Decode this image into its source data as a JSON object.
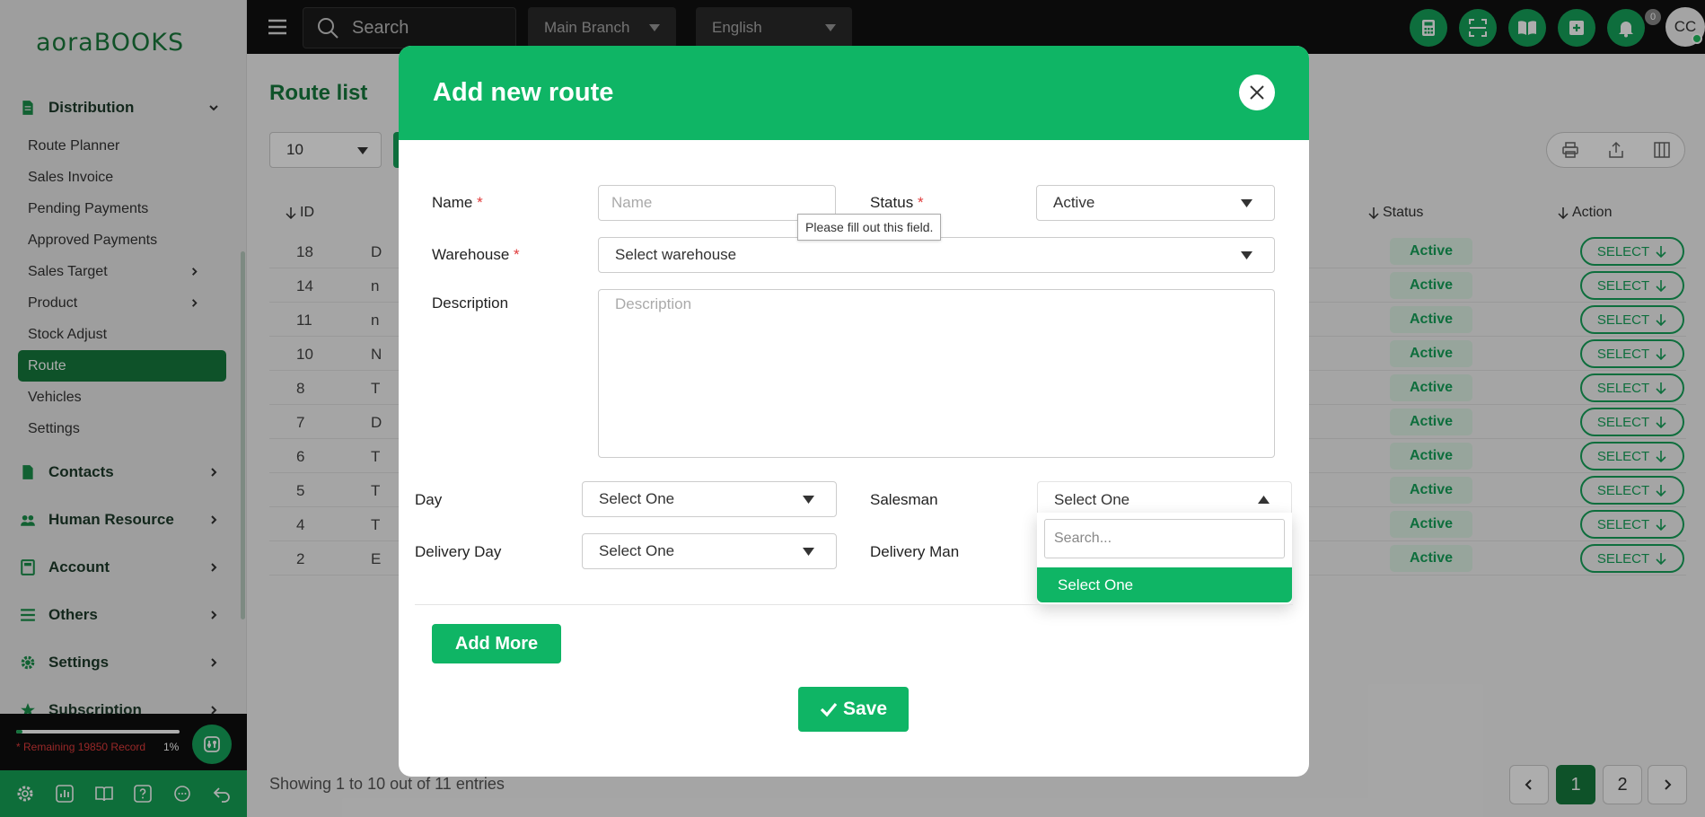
{
  "app": {
    "logo_text": "aoraBOOKS"
  },
  "sidebar": {
    "groups_top": [
      {
        "label": "Distribution",
        "icon": "document-icon"
      }
    ],
    "distribution_items": [
      {
        "label": "Route Planner"
      },
      {
        "label": "Sales Invoice"
      },
      {
        "label": "Pending Payments"
      },
      {
        "label": "Approved Payments"
      },
      {
        "label": "Sales Target"
      },
      {
        "label": "Product"
      },
      {
        "label": "Stock Adjust"
      },
      {
        "label": "Route"
      },
      {
        "label": "Vehicles"
      },
      {
        "label": "Settings"
      }
    ],
    "groups": [
      {
        "label": "Contacts",
        "icon": "document-icon"
      },
      {
        "label": "Human Resource",
        "icon": "users-icon"
      },
      {
        "label": "Account",
        "icon": "calculator-icon"
      },
      {
        "label": "Others",
        "icon": "list-icon"
      },
      {
        "label": "Settings",
        "icon": "gear-icon"
      },
      {
        "label": "Subscription",
        "icon": "star-icon"
      }
    ],
    "records": {
      "text": "* Remaining 19850 Record",
      "percent": "1%",
      "fraction": 0.01
    }
  },
  "topbar": {
    "search_placeholder": "Search",
    "branch": "Main Branch",
    "language": "English",
    "notification_count": "0",
    "avatar_initials": "CC"
  },
  "main": {
    "title": "Route list",
    "per_page": "10",
    "headers": {
      "id": "ID",
      "status": "Status",
      "action": "Action"
    },
    "rows": [
      {
        "id": "18",
        "name": "D",
        "status": "Active",
        "action": "SELECT"
      },
      {
        "id": "14",
        "name": "n",
        "status": "Active",
        "action": "SELECT"
      },
      {
        "id": "11",
        "name": "n",
        "status": "Active",
        "action": "SELECT"
      },
      {
        "id": "10",
        "name": "N",
        "status": "Active",
        "action": "SELECT"
      },
      {
        "id": "8",
        "name": "T",
        "status": "Active",
        "action": "SELECT"
      },
      {
        "id": "7",
        "name": "D",
        "status": "Active",
        "action": "SELECT"
      },
      {
        "id": "6",
        "name": "T",
        "status": "Active",
        "action": "SELECT"
      },
      {
        "id": "5",
        "name": "T",
        "status": "Active",
        "action": "SELECT"
      },
      {
        "id": "4",
        "name": "T",
        "status": "Active",
        "action": "SELECT"
      },
      {
        "id": "2",
        "name": "E",
        "status": "Active",
        "action": "SELECT"
      }
    ],
    "showing": "Showing 1 to 10 out of 11 entries",
    "pages": [
      "1",
      "2"
    ]
  },
  "modal": {
    "title": "Add new route",
    "name_label": "Name",
    "name_placeholder": "Name",
    "status_label": "Status",
    "status_value": "Active",
    "tooltip": "Please fill out this field.",
    "warehouse_label": "Warehouse",
    "warehouse_value": "Select warehouse",
    "description_label": "Description",
    "description_placeholder": "Description",
    "day_label": "Day",
    "day_value": "Select One",
    "salesman_label": "Salesman",
    "salesman_value": "Select One",
    "delivery_day_label": "Delivery Day",
    "delivery_day_value": "Select One",
    "delivery_man_label": "Delivery Man",
    "dropdown_search_placeholder": "Search...",
    "dropdown_option": "Select One",
    "add_more_label": "Add More",
    "save_label": "Save",
    "required_mark": "*"
  },
  "colors": {
    "brand_green": "#0fb565",
    "dark_green": "#157a3d",
    "required_red": "#e03b3b"
  }
}
